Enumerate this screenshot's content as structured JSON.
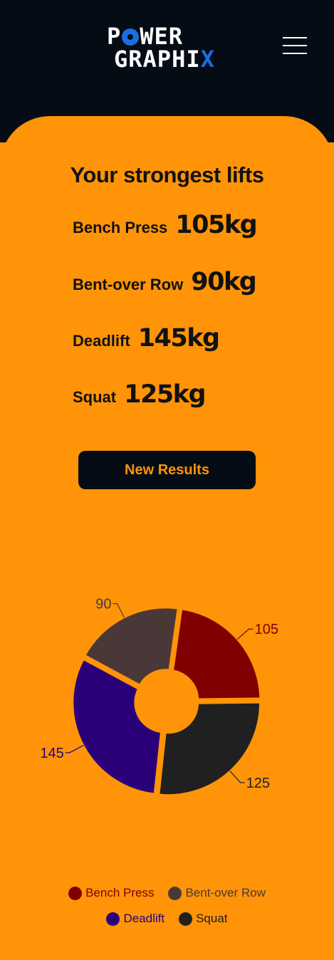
{
  "brand": {
    "line1_pre": "P",
    "line1_post": "WER",
    "line2_pre": "GRAPHI",
    "line2_accent": "X"
  },
  "icons": {
    "menu": "hamburger-icon",
    "logo_plate": "weight-plate-icon"
  },
  "colors": {
    "header_bg": "#060c16",
    "page_bg": "#ff9408",
    "accent_blue": "#1a6fe0"
  },
  "lifts": {
    "title": "Your strongest lifts",
    "items": [
      {
        "name": "Bench Press",
        "value": "105kg"
      },
      {
        "name": "Bent-over Row",
        "value": "90kg"
      },
      {
        "name": "Deadlift",
        "value": "145kg"
      },
      {
        "name": "Squat",
        "value": "125kg"
      }
    ]
  },
  "cta": {
    "label": "New Results"
  },
  "chart_data": {
    "type": "pie",
    "donut": true,
    "title": "",
    "categories": [
      "Bench Press",
      "Squat",
      "Deadlift",
      "Bent-over Row"
    ],
    "values": [
      105,
      125,
      145,
      90
    ],
    "colors": [
      "#800000",
      "#202020",
      "#2a0078",
      "#4a3838"
    ],
    "label_colors": [
      "#800000",
      "#202020",
      "#2a0078",
      "#4a3838"
    ],
    "legend": {
      "position": "bottom",
      "items": [
        {
          "label": "Bench Press",
          "color": "#800000"
        },
        {
          "label": "Bent-over Row",
          "color": "#4a3838"
        },
        {
          "label": "Deadlift",
          "color": "#2a0078"
        },
        {
          "label": "Squat",
          "color": "#202020"
        }
      ]
    }
  }
}
